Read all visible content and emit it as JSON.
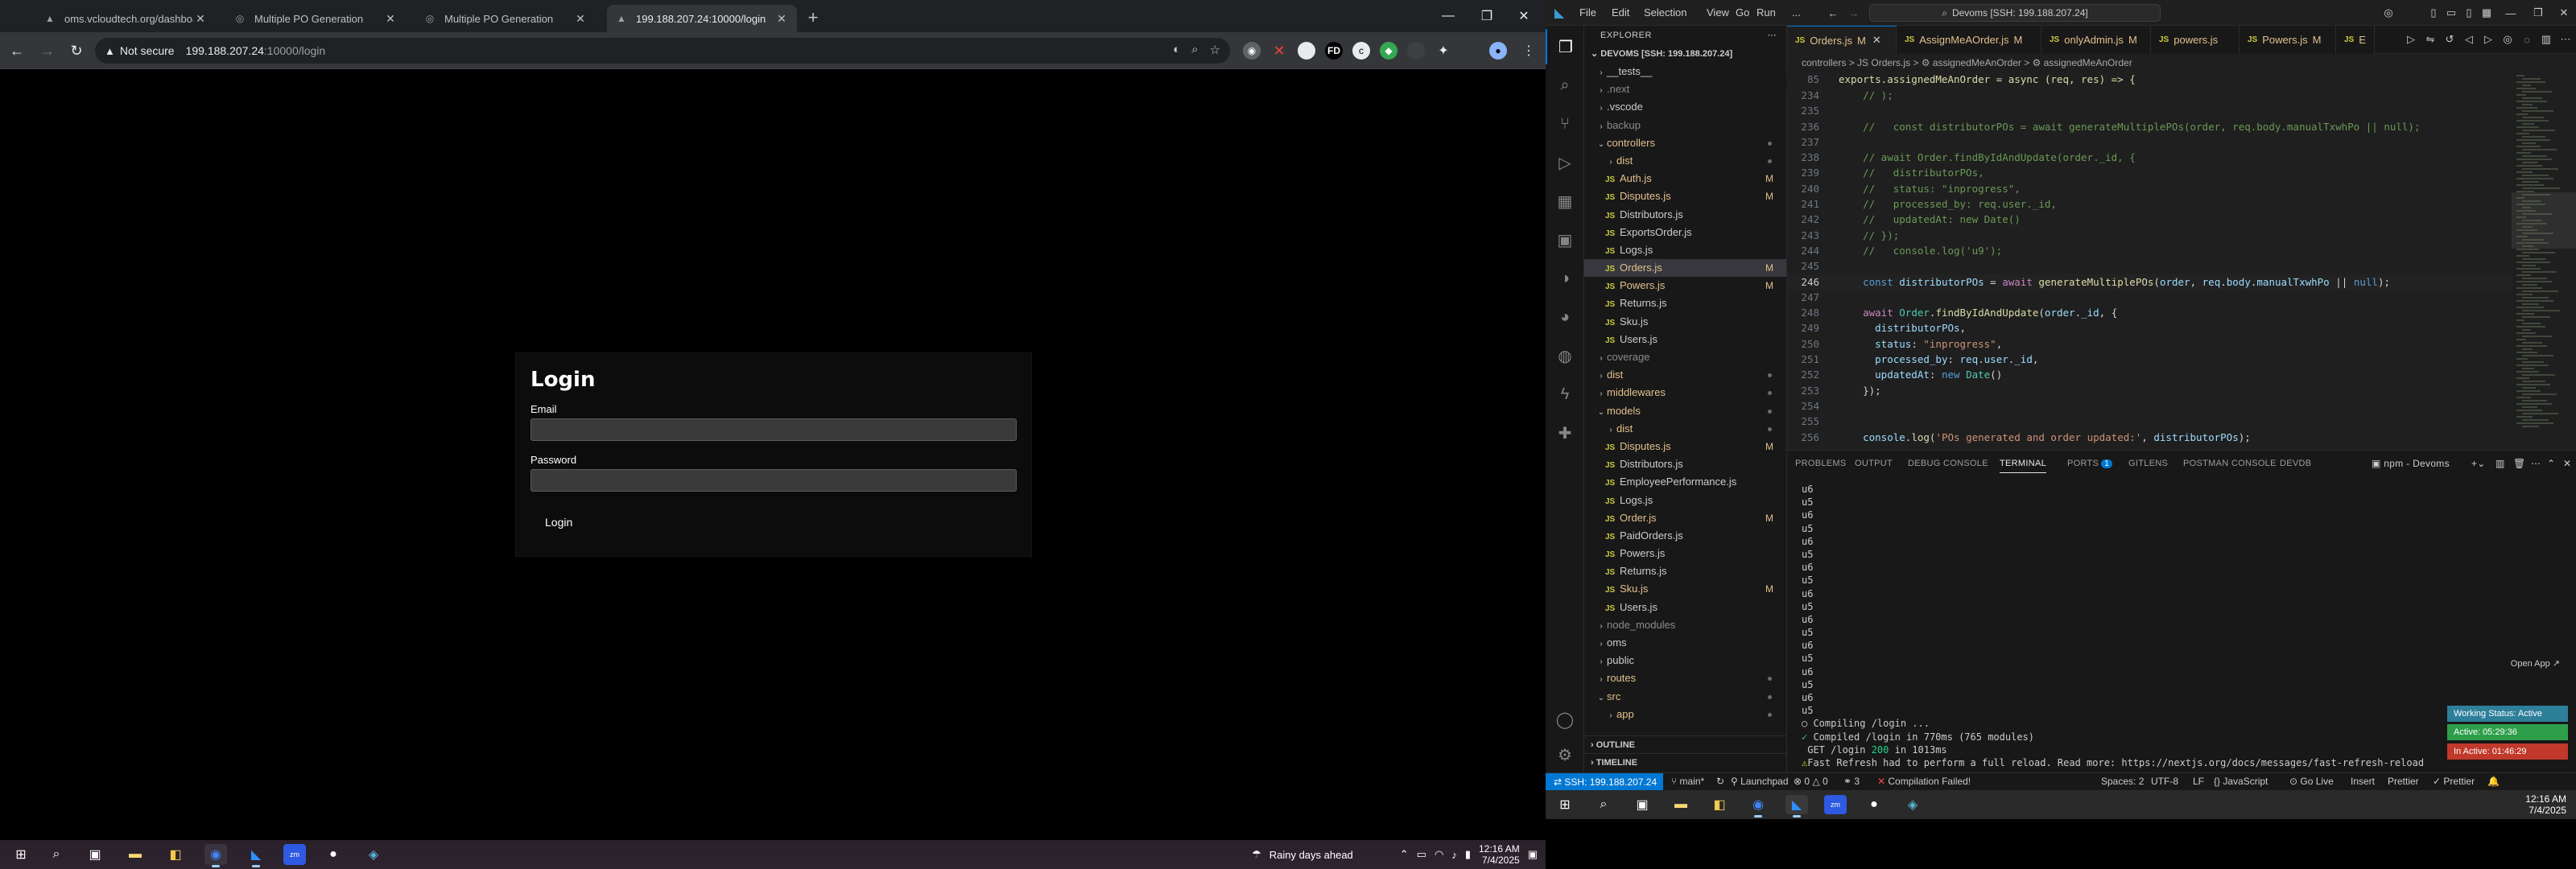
{
  "chrome": {
    "tabs": [
      {
        "title": "oms.vcloudtech.org/dashboard",
        "active": false
      },
      {
        "title": "Multiple PO Generation",
        "active": false
      },
      {
        "title": "Multiple PO Generation",
        "active": false
      },
      {
        "title": "199.188.207.24:10000/login",
        "active": true
      }
    ],
    "address": {
      "security": "Not secure",
      "host": "199.188.207.24",
      "port_path": ":10000/login"
    },
    "login": {
      "heading": "Login",
      "email_label": "Email",
      "email_value": "",
      "password_label": "Password",
      "password_value": "",
      "button": "Login"
    },
    "taskbar": {
      "weather": "Rainy days ahead",
      "time": "12:16 AM",
      "date": "7/4/2025"
    }
  },
  "vscode": {
    "menu": [
      "File",
      "Edit",
      "Selection",
      "View",
      "Go",
      "Run",
      "..."
    ],
    "search": "Devoms [SSH: 199.188.207.24]",
    "explorer_title": "EXPLORER",
    "project": "DEVOMS [SSH: 199.188.207.24]",
    "tree": [
      {
        "label": "__tests__",
        "type": "folder",
        "depth": 1,
        "open": false,
        "state": ""
      },
      {
        "label": ".next",
        "type": "folder",
        "depth": 1,
        "open": false,
        "state": "dim"
      },
      {
        "label": ".vscode",
        "type": "folder",
        "depth": 1,
        "open": false,
        "state": ""
      },
      {
        "label": "backup",
        "type": "folder",
        "depth": 1,
        "open": false,
        "state": "dim"
      },
      {
        "label": "controllers",
        "type": "folder",
        "depth": 1,
        "open": true,
        "state": "mod",
        "dot": true
      },
      {
        "label": "dist",
        "type": "folder",
        "depth": 2,
        "open": false,
        "state": "mod",
        "dot": true
      },
      {
        "label": "Auth.js",
        "type": "js",
        "depth": 2,
        "state": "mod",
        "badge": "M"
      },
      {
        "label": "Disputes.js",
        "type": "js",
        "depth": 2,
        "state": "mod",
        "badge": "M"
      },
      {
        "label": "Distributors.js",
        "type": "js",
        "depth": 2,
        "state": ""
      },
      {
        "label": "ExportsOrder.js",
        "type": "js",
        "depth": 2,
        "state": ""
      },
      {
        "label": "Logs.js",
        "type": "js",
        "depth": 2,
        "state": ""
      },
      {
        "label": "Orders.js",
        "type": "js",
        "depth": 2,
        "state": "mod",
        "badge": "M",
        "selected": true
      },
      {
        "label": "Powers.js",
        "type": "js",
        "depth": 2,
        "state": "mod",
        "badge": "M"
      },
      {
        "label": "Returns.js",
        "type": "js",
        "depth": 2,
        "state": ""
      },
      {
        "label": "Sku.js",
        "type": "js",
        "depth": 2,
        "state": ""
      },
      {
        "label": "Users.js",
        "type": "js",
        "depth": 2,
        "state": ""
      },
      {
        "label": "coverage",
        "type": "folder",
        "depth": 1,
        "open": false,
        "state": "dim"
      },
      {
        "label": "dist",
        "type": "folder",
        "depth": 1,
        "open": false,
        "state": "mod",
        "dot": true
      },
      {
        "label": "middlewares",
        "type": "folder",
        "depth": 1,
        "open": false,
        "state": "mod",
        "dot": true
      },
      {
        "label": "models",
        "type": "folder",
        "depth": 1,
        "open": true,
        "state": "mod",
        "dot": true
      },
      {
        "label": "dist",
        "type": "folder",
        "depth": 2,
        "open": false,
        "state": "mod",
        "dot": true
      },
      {
        "label": "Disputes.js",
        "type": "js",
        "depth": 2,
        "state": "mod",
        "badge": "M"
      },
      {
        "label": "Distributors.js",
        "type": "js",
        "depth": 2,
        "state": ""
      },
      {
        "label": "EmployeePerformance.js",
        "type": "js",
        "depth": 2,
        "state": ""
      },
      {
        "label": "Logs.js",
        "type": "js",
        "depth": 2,
        "state": ""
      },
      {
        "label": "Order.js",
        "type": "js",
        "depth": 2,
        "state": "mod",
        "badge": "M"
      },
      {
        "label": "PaidOrders.js",
        "type": "js",
        "depth": 2,
        "state": ""
      },
      {
        "label": "Powers.js",
        "type": "js",
        "depth": 2,
        "state": ""
      },
      {
        "label": "Returns.js",
        "type": "js",
        "depth": 2,
        "state": ""
      },
      {
        "label": "Sku.js",
        "type": "js",
        "depth": 2,
        "state": "mod",
        "badge": "M"
      },
      {
        "label": "Users.js",
        "type": "js",
        "depth": 2,
        "state": ""
      },
      {
        "label": "node_modules",
        "type": "folder",
        "depth": 1,
        "open": false,
        "state": "dim"
      },
      {
        "label": "oms",
        "type": "folder",
        "depth": 1,
        "open": false,
        "state": ""
      },
      {
        "label": "public",
        "type": "folder",
        "depth": 1,
        "open": false,
        "state": ""
      },
      {
        "label": "routes",
        "type": "folder",
        "depth": 1,
        "open": false,
        "state": "mod",
        "dot": true
      },
      {
        "label": "src",
        "type": "folder",
        "depth": 1,
        "open": true,
        "state": "mod",
        "dot": true
      },
      {
        "label": "app",
        "type": "folder",
        "depth": 2,
        "open": false,
        "state": "mod",
        "dot": true
      }
    ],
    "outline": "OUTLINE",
    "timeline": "TIMELINE",
    "tabs": [
      {
        "label": "Orders.js",
        "badge": "M",
        "active": true,
        "close": true
      },
      {
        "label": "AssignMeAOrder.js",
        "badge": "M"
      },
      {
        "label": "onlyAdmin.js",
        "badge": "M"
      },
      {
        "label": "powers.js",
        "badge": ""
      },
      {
        "label": "Powers.js",
        "badge": "M"
      },
      {
        "label": "E",
        "badge": ""
      }
    ],
    "breadcrumb": "controllers  >  JS Orders.js  >  ⚙ assignedMeAnOrder  >  ⚙ assignedMeAnOrder",
    "sticky_line": {
      "n": "85",
      "code": "exports.assignedMeAnOrder = async (req, res) => {"
    },
    "code": [
      {
        "n": "234",
        "html": "    <span class='c'>// );</span>"
      },
      {
        "n": "235",
        "html": ""
      },
      {
        "n": "236",
        "html": "    <span class='c'>//   const distributorPOs = await generateMultiplePOs(order, req.body.manualTxwhPo || null);</span>"
      },
      {
        "n": "237",
        "html": ""
      },
      {
        "n": "238",
        "html": "    <span class='c'>// await Order.findByIdAndUpdate(order._id, {</span>"
      },
      {
        "n": "239",
        "html": "    <span class='c'>//   distributorPOs,</span>"
      },
      {
        "n": "240",
        "html": "    <span class='c'>//   status: \"inprogress\",</span>"
      },
      {
        "n": "241",
        "html": "    <span class='c'>//   processed_by: req.user._id,</span>"
      },
      {
        "n": "242",
        "html": "    <span class='c'>//   updatedAt: new Date()</span>"
      },
      {
        "n": "243",
        "html": "    <span class='c'>// });</span>"
      },
      {
        "n": "244",
        "html": "    <span class='c'>//   console.log('u9');</span>"
      },
      {
        "n": "245",
        "html": ""
      },
      {
        "n": "246",
        "html": "    <span class='k'>const</span> <span class='v'>distributorPOs</span> <span class='o'>=</span> <span class='pk'>await</span> <span class='f'>generateMultiplePOs</span><span class='o'>(</span><span class='v'>order</span><span class='o'>, </span><span class='v'>req</span><span class='o'>.</span><span class='v'>body</span><span class='o'>.</span><span class='v'>manualTxwhPo</span> <span class='o'>||</span> <span class='k'>null</span><span class='o'>);</span>",
        "cur": true
      },
      {
        "n": "247",
        "html": ""
      },
      {
        "n": "248",
        "html": "    <span class='pk'>await</span> <span class='t'>Order</span><span class='o'>.</span><span class='f'>findByIdAndUpdate</span><span class='o'>(</span><span class='v'>order</span><span class='o'>.</span><span class='v'>_id</span><span class='o'>, {</span>"
      },
      {
        "n": "249",
        "html": "      <span class='v'>distributorPOs</span><span class='o'>,</span>"
      },
      {
        "n": "250",
        "html": "      <span class='v'>status</span><span class='o'>: </span><span class='s'>\"inprogress\"</span><span class='o'>,</span>"
      },
      {
        "n": "251",
        "html": "      <span class='v'>processed_by</span><span class='o'>: </span><span class='v'>req</span><span class='o'>.</span><span class='v'>user</span><span class='o'>.</span><span class='v'>_id</span><span class='o'>,</span>"
      },
      {
        "n": "252",
        "html": "      <span class='v'>updatedAt</span><span class='o'>: </span><span class='k'>new</span> <span class='t'>Date</span><span class='o'>()</span>"
      },
      {
        "n": "253",
        "html": "    <span class='o'>});</span>"
      },
      {
        "n": "254",
        "html": ""
      },
      {
        "n": "255",
        "html": ""
      },
      {
        "n": "256",
        "html": "    <span class='v'>console</span><span class='o'>.</span><span class='f'>log</span><span class='o'>(</span><span class='s'>'POs generated and order updated:'</span><span class='o'>, </span><span class='v'>distributorPOs</span><span class='o'>);</span>"
      }
    ],
    "panel_tabs": [
      "PROBLEMS",
      "OUTPUT",
      "DEBUG CONSOLE",
      "TERMINAL",
      "PORTS",
      "GITLENS",
      "POSTMAN CONSOLE",
      "DEVDB"
    ],
    "ports_count": "1",
    "terminal_name": "npm - Devoms",
    "terminal": [
      {
        "t": "u6"
      },
      {
        "t": "u5"
      },
      {
        "t": "u6"
      },
      {
        "t": "u5"
      },
      {
        "t": "u6"
      },
      {
        "t": "u5"
      },
      {
        "t": "u6"
      },
      {
        "t": "u5"
      },
      {
        "t": "u6"
      },
      {
        "t": "u5"
      },
      {
        "t": "u6"
      },
      {
        "t": "u5"
      },
      {
        "t": "u6"
      },
      {
        "t": "u5"
      },
      {
        "t": "u6"
      },
      {
        "t": "u5"
      },
      {
        "t": "u6"
      },
      {
        "t": "u5"
      },
      {
        "t": "○ Compiling /login ..."
      },
      {
        "t": "✓ Compiled /login in 770ms (765 modules)",
        "cls": "green-first"
      },
      {
        "t": "GET /login 200 in 1013ms",
        "cls": "get"
      },
      {
        "t": "⚠Fast Refresh had to perform a full reload. Read more: https://nextjs.org/docs/messages/fast-refresh-reload",
        "cls": "warn"
      },
      {
        "t": "▯"
      }
    ],
    "open_app": "Open App ↗",
    "working_status": "Working Status: Active",
    "active_time": "Active: 05:29:36",
    "inactive_time": "In Active: 01:46:29",
    "status": {
      "remote": "SSH: 199.188.207.24",
      "branch": "main*",
      "launchpad": "Launchpad",
      "errors": "0",
      "warnings": "0",
      "ports": "3",
      "compile": "Compilation Failed!",
      "spaces": "Spaces: 2",
      "encoding": "UTF-8",
      "eol": "LF",
      "lang": "JavaScript",
      "golive": "Go Live",
      "insert": "Insert",
      "prettier1": "Prettier",
      "prettier2": "Prettier"
    },
    "taskbar": {
      "time": "12:16 AM",
      "date": "7/4/2025"
    }
  }
}
